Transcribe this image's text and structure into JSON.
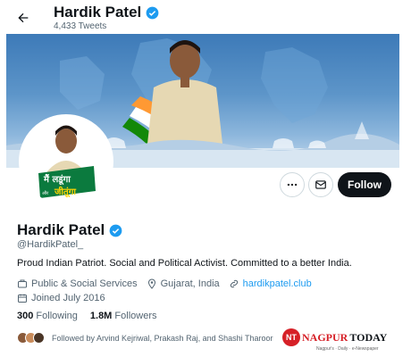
{
  "header": {
    "name": "Hardik Patel",
    "tweets": "4,433 Tweets"
  },
  "banner": {
    "description": "Cover photo with campaign image"
  },
  "avatar": {
    "line1": "मैं लडूंगा",
    "line2": "जीतूंगा",
    "connector": "और"
  },
  "actions": {
    "follow_label": "Follow"
  },
  "profile": {
    "name": "Hardik Patel",
    "handle": "@HardikPatel_",
    "bio": "Proud Indian Patriot. Social and Political Activist. Committed to a better India.",
    "category": "Public & Social Services",
    "location": "Gujarat, India",
    "website": "hardikpatel.club",
    "joined": "Joined July 2016"
  },
  "stats": {
    "following_count": "300",
    "following_label": "Following",
    "followers_count": "1.8M",
    "followers_label": "Followers"
  },
  "followed_by": {
    "text": "Followed by Arvind Kejriwal, Prakash Raj, and Shashi Tharoor"
  },
  "watermark": {
    "logo": "NT",
    "brand1": "NAGPUR",
    "brand2": "TODAY",
    "tagline": "Nagpur's · Daily · e-Newspaper"
  },
  "colors": {
    "accent": "#1d9bf0",
    "verified": "#1d9bf0",
    "follow_bg": "#0f1419",
    "secondary_text": "#536471"
  }
}
